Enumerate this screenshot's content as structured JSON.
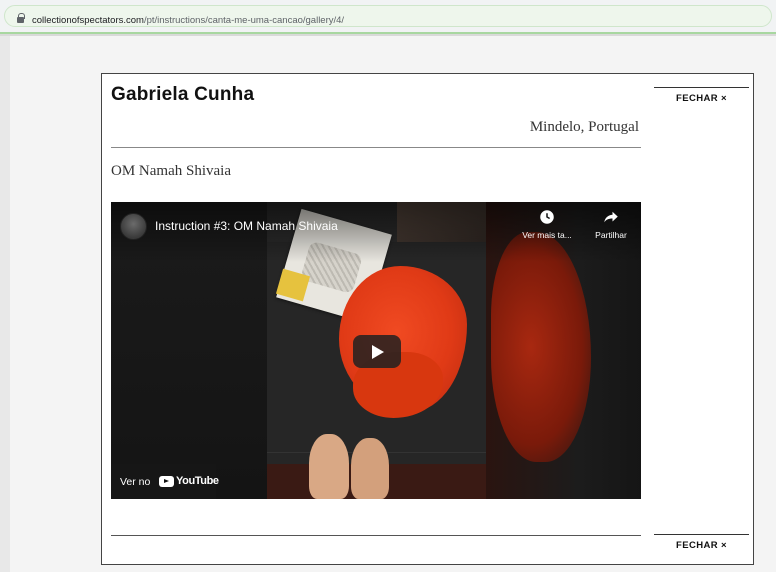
{
  "browser": {
    "url_host": "collectionofspectators.com",
    "url_path": "/pt/instructions/canta-me-uma-cancao/gallery/4/"
  },
  "modal": {
    "name": "Gabriela Cunha",
    "location": "Mindelo, Portugal",
    "song_title": "OM Namah Shivaia",
    "close_label": "FECHAR ×"
  },
  "video": {
    "title": "Instruction #3: OM Namah Shivaia",
    "watch_later_label": "Ver mais ta...",
    "share_label": "Partilhar",
    "watch_on_label": "Ver no",
    "youtube_label": "YouTube",
    "icons": [
      "channel-avatar",
      "clock-icon",
      "share-arrow-icon",
      "play-icon",
      "youtube-logo-icon"
    ]
  },
  "colors": {
    "accent_green": "#a8d7a0",
    "cloth_red": "#e03a16"
  }
}
